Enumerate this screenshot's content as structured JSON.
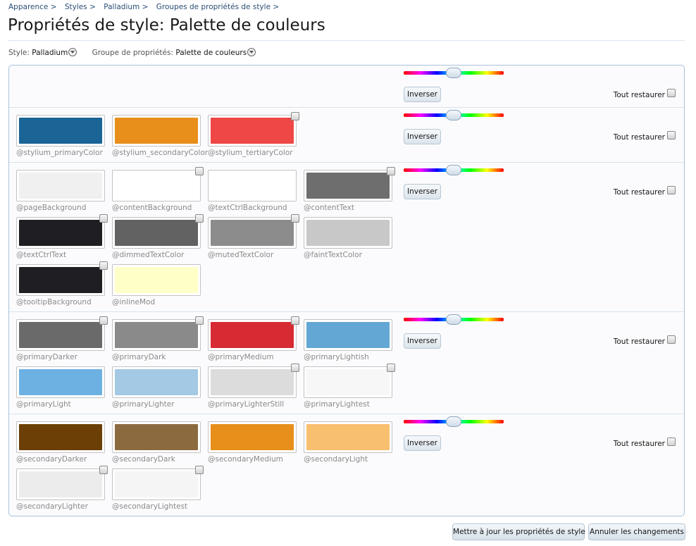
{
  "breadcrumb": [
    "Apparence",
    "Styles",
    "Palladium",
    "Groupes de propriétés de style"
  ],
  "breadcrumb_sep": ">",
  "title": "Propriétés de style: Palette de couleurs",
  "selectors": {
    "style_label": "Style:",
    "style_value": "Palladium",
    "group_label": "Groupe de propriétés:",
    "group_value": "Palette de couleurs"
  },
  "controls": {
    "invert_label": "Inverser",
    "restore_label": "Tout restaurer"
  },
  "groups": [
    {
      "swatches": []
    },
    {
      "swatches": [
        {
          "name": "@stylium_primaryColor",
          "color": "#1a6496",
          "checkbox": false
        },
        {
          "name": "@stylium_secondaryColor",
          "color": "#e78e1b",
          "checkbox": false
        },
        {
          "name": "@stylium_tertiaryColor",
          "color": "#ef4646",
          "checkbox": true
        }
      ]
    },
    {
      "swatches": [
        {
          "name": "@pageBackground",
          "color": "#f0f0f0",
          "checkbox": false
        },
        {
          "name": "@contentBackground",
          "color": "#ffffff",
          "checkbox": true
        },
        {
          "name": "@textCtrlBackground",
          "color": "#ffffff",
          "checkbox": false
        },
        {
          "name": "@contentText",
          "color": "#6e6e6e",
          "checkbox": true
        },
        {
          "name": "@textCtrlText",
          "color": "#1f1f23",
          "checkbox": true
        },
        {
          "name": "@dimmedTextColor",
          "color": "#626262",
          "checkbox": true
        },
        {
          "name": "@mutedTextColor",
          "color": "#8c8c8c",
          "checkbox": true
        },
        {
          "name": "@faintTextColor",
          "color": "#c8c8c8",
          "checkbox": false
        },
        {
          "name": "@tooltipBackground",
          "color": "#1f1f23",
          "checkbox": true
        },
        {
          "name": "@inlineMod",
          "color": "#ffffc8",
          "checkbox": false
        }
      ]
    },
    {
      "swatches": [
        {
          "name": "@primaryDarker",
          "color": "#6a6a6a",
          "checkbox": true
        },
        {
          "name": "@primaryDark",
          "color": "#8a8a8a",
          "checkbox": true
        },
        {
          "name": "@primaryMedium",
          "color": "#d72b33",
          "checkbox": true
        },
        {
          "name": "@primaryLightish",
          "color": "#63a7d4",
          "checkbox": false
        },
        {
          "name": "@primaryLight",
          "color": "#6db1e3",
          "checkbox": false
        },
        {
          "name": "@primaryLighter",
          "color": "#a3c9e4",
          "checkbox": false
        },
        {
          "name": "@primaryLighterStill",
          "color": "#dcdcdc",
          "checkbox": true
        },
        {
          "name": "@primaryLightest",
          "color": "#f7f7f7",
          "checkbox": true
        }
      ]
    },
    {
      "swatches": [
        {
          "name": "@secondaryDarker",
          "color": "#6b3f05",
          "checkbox": false
        },
        {
          "name": "@secondaryDark",
          "color": "#8c6a40",
          "checkbox": false
        },
        {
          "name": "@secondaryMedium",
          "color": "#e78e1b",
          "checkbox": false
        },
        {
          "name": "@secondaryLight",
          "color": "#f8bf6f",
          "checkbox": false
        },
        {
          "name": "@secondaryLighter",
          "color": "#ececec",
          "checkbox": true
        },
        {
          "name": "@secondaryLightest",
          "color": "#f5f5f5",
          "checkbox": true
        }
      ]
    }
  ],
  "footer": {
    "update_label": "Mettre à jour les propriétés de style",
    "cancel_label": "Annuler les changements"
  }
}
